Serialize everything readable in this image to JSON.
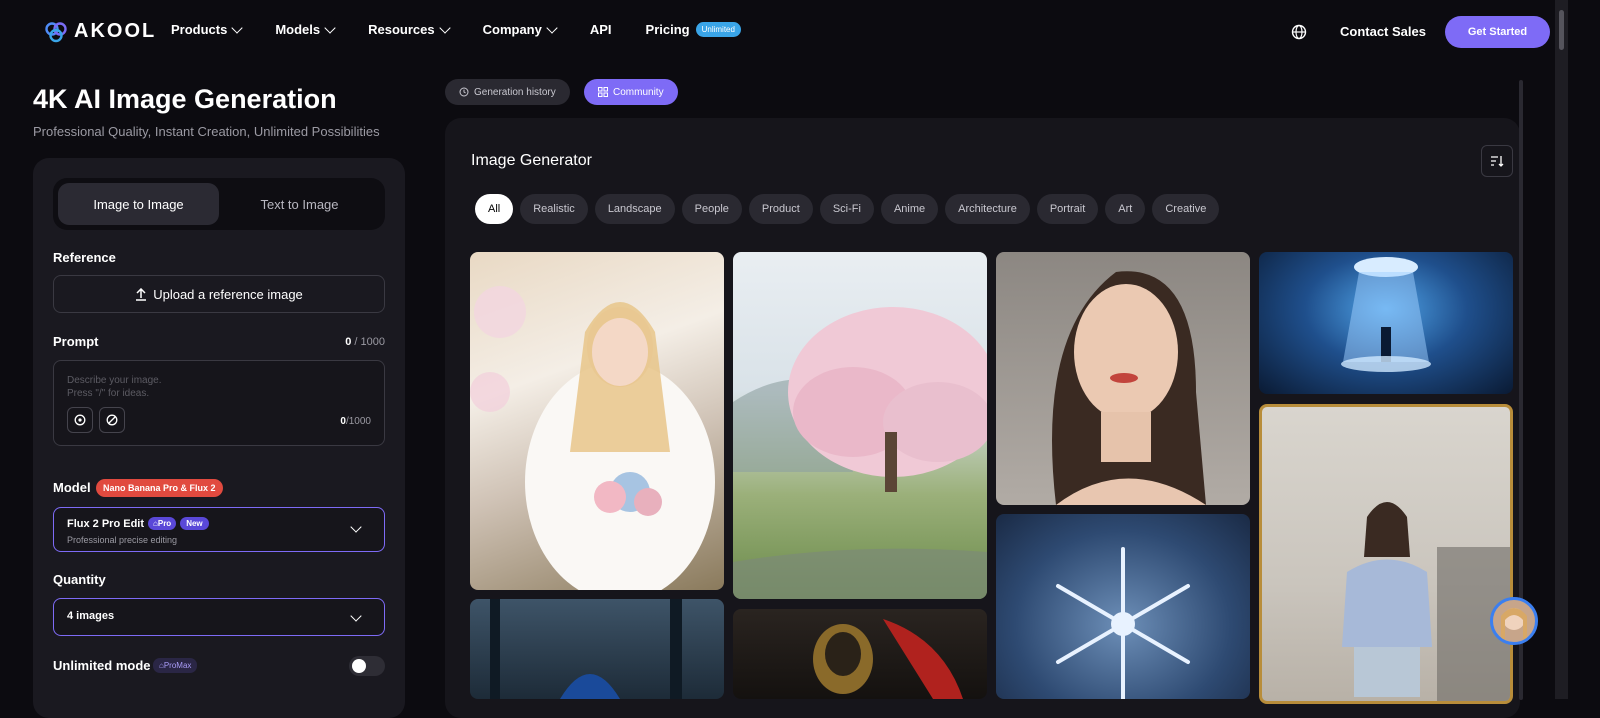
{
  "brand": {
    "name": "AKOOL"
  },
  "nav": {
    "items": [
      "Products",
      "Models",
      "Resources",
      "Company",
      "API",
      "Pricing"
    ],
    "pricing_badge": "Unlimited",
    "contact": "Contact Sales",
    "cta": "Get Started"
  },
  "hero": {
    "title": "4K AI Image Generation",
    "subtitle": "Professional Quality, Instant Creation, Unlimited Possibilities"
  },
  "form": {
    "tabs": [
      "Image to Image",
      "Text to Image"
    ],
    "reference_label": "Reference",
    "upload_label": "Upload a reference image",
    "prompt_label": "Prompt",
    "prompt_count": "0",
    "prompt_max": "/ 1000",
    "prompt_placeholder_1": "Describe your image.",
    "prompt_placeholder_2": "Press \"/\" for ideas.",
    "inner_count": "0",
    "inner_max": "/1000",
    "model_label": "Model",
    "model_badge": "Nano Banana Pro & Flux 2",
    "model_name": "Flux 2 Pro Edit",
    "model_tag_pro": "Pro",
    "model_tag_new": "New",
    "model_desc": "Professional precise editing",
    "quantity_label": "Quantity",
    "quantity_value": "4 images",
    "unlimited_label": "Unlimited mode",
    "unlimited_badge": "ProMax"
  },
  "gallery": {
    "tab_history": "Generation history",
    "tab_community": "Community",
    "title": "Image Generator",
    "categories": [
      "All",
      "Realistic",
      "Landscape",
      "People",
      "Product",
      "Sci-Fi",
      "Anime",
      "Architecture",
      "Portrait",
      "Art",
      "Creative"
    ]
  },
  "colors": {
    "accent": "#7e6bf6",
    "badge_red": "#e14a3f",
    "unlimited_blue": "#3aa5e8"
  }
}
